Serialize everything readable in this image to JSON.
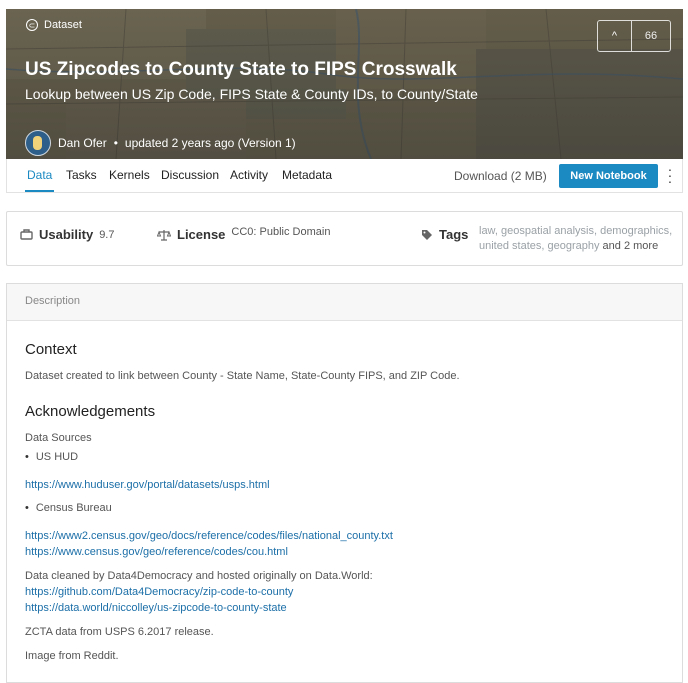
{
  "header": {
    "badge": "Dataset",
    "title": "US Zipcodes to County State to FIPS Crosswalk",
    "subtitle": "Lookup between US Zip Code, FIPS State & County IDs, to County/State",
    "author": "Dan Ofer",
    "updated": "updated 2 years ago (Version 1)",
    "votes": "66"
  },
  "tabs": [
    {
      "label": "Data"
    },
    {
      "label": "Tasks"
    },
    {
      "label": "Kernels"
    },
    {
      "label": "Discussion"
    },
    {
      "label": "Activity"
    },
    {
      "label": "Metadata"
    }
  ],
  "actions": {
    "download": "Download (2 MB)",
    "new_notebook": "New Notebook"
  },
  "stats": {
    "usability_label": "Usability",
    "usability_value": "9.7",
    "license_label": "License",
    "license_value": "CC0: Public Domain",
    "tags_label": "Tags",
    "tags_line1": "law, geospatial analysis, demographics,",
    "tags_line2": "united states, geography",
    "tags_more": "and 2 more"
  },
  "description": {
    "header": "Description",
    "context_heading": "Context",
    "context_text": "Dataset created to link between County - State Name, State-County FIPS, and ZIP Code.",
    "ack_heading": "Acknowledgements",
    "data_sources": "Data Sources",
    "source1": "US HUD",
    "link1": "https://www.huduser.gov/portal/datasets/usps.html",
    "source2": "Census Bureau",
    "link2": "https://www2.census.gov/geo/docs/reference/codes/files/national_county.txt",
    "link3": "https://www.census.gov/geo/reference/codes/cou.html",
    "cleaned": "Data cleaned by Data4Democracy and hosted originally on Data.World:",
    "link4": "https://github.com/Data4Democracy/zip-code-to-county",
    "link5": "https://data.world/niccolley/us-zipcode-to-county-state",
    "zcta": "ZCTA data from USPS 6.2017 release.",
    "image": "Image from Reddit."
  }
}
